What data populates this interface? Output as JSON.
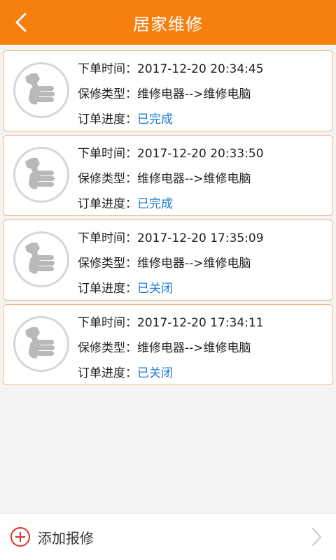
{
  "header": {
    "title": "居家维修",
    "back_icon": "chevron-left-icon"
  },
  "labels": {
    "time": "下单时间：",
    "type": "保修类型：",
    "progress": "订单进度："
  },
  "orders": [
    {
      "time": "2017-12-20 20:34:45",
      "type": "维修电器-->维修电脑",
      "status": "已完成"
    },
    {
      "time": "2017-12-20 20:33:50",
      "type": "维修电器-->维修电脑",
      "status": "已完成"
    },
    {
      "time": "2017-12-20 17:35:09",
      "type": "维修电器-->维修电脑",
      "status": "已关闭"
    },
    {
      "time": "2017-12-20 17:34:11",
      "type": "维修电器-->维修电脑",
      "status": "已关闭"
    }
  ],
  "bottom": {
    "add_label": "添加报修",
    "add_icon": "plus-circle-icon",
    "chevron_icon": "chevron-right-icon"
  },
  "colors": {
    "accent": "#f77f0f",
    "status_blue": "#1e7ad6",
    "card_border": "#f2b67d",
    "add_red": "#e0312b"
  }
}
